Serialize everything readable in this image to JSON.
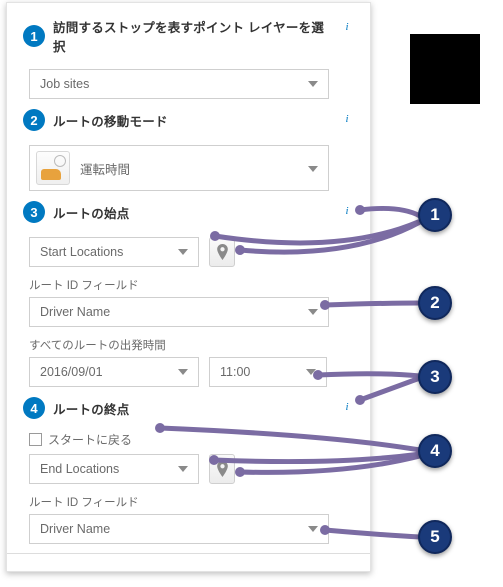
{
  "steps": {
    "s1": {
      "num": "1",
      "title": "訪問するストップを表すポイント レイヤーを選択"
    },
    "s2": {
      "num": "2",
      "title": "ルートの移動モード"
    },
    "s3": {
      "num": "3",
      "title": "ルートの始点"
    },
    "s4": {
      "num": "4",
      "title": "ルートの終点"
    }
  },
  "stops": {
    "layer": "Job sites"
  },
  "mode": {
    "value": "運転時間"
  },
  "start": {
    "layer": "Start Locations",
    "id_label": "ルート ID フィールド",
    "id_field": "Driver Name",
    "depart_label": "すべてのルートの出発時間",
    "date": "2016/09/01",
    "time": "11:00"
  },
  "end": {
    "return_label": "スタートに戻る",
    "return_checked": false,
    "layer": "End Locations",
    "id_label": "ルート ID フィールド",
    "id_field": "Driver Name"
  },
  "callouts": {
    "c1": "1",
    "c2": "2",
    "c3": "3",
    "c4": "4",
    "c5": "5"
  },
  "info_glyph": "i"
}
